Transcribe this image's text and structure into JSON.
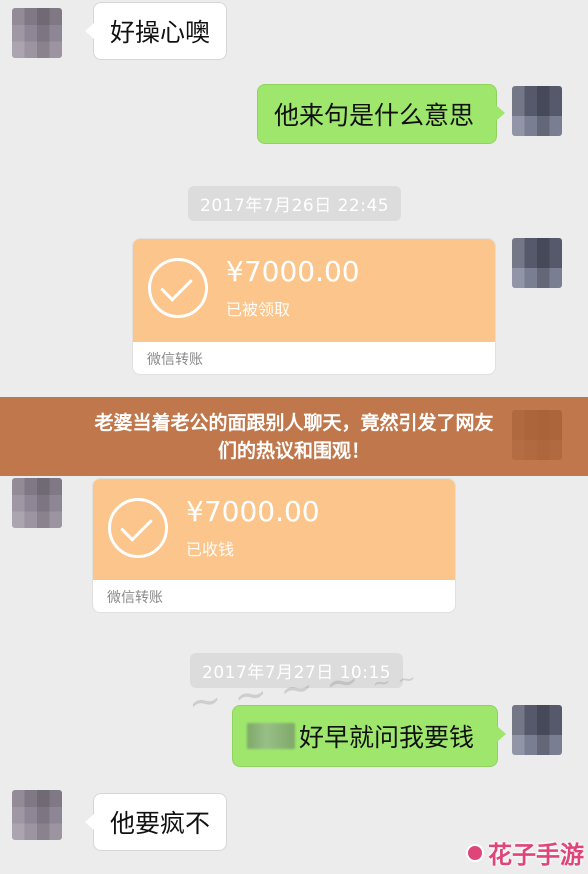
{
  "messages": {
    "m1": "好操心噢",
    "m2": "他来句是什么意思",
    "m5": "好早就问我要钱",
    "m6": "他要疯不"
  },
  "timestamps": {
    "t1": "2017年7月26日 22:45",
    "t2": "2017年7月27日 10:15"
  },
  "transfers": {
    "sent": {
      "amount": "¥7000.00",
      "status": "已被领取",
      "footer": "微信转账"
    },
    "received": {
      "amount": "¥7000.00",
      "status": "已收钱",
      "footer": "微信转账"
    }
  },
  "banner": {
    "line1": "老婆当着老公的面跟别人聊天，竟然引发了网友",
    "line2": "们的热议和围观！"
  },
  "logo": {
    "text": "花子手游"
  },
  "colors": {
    "chat_bg": "#ececec",
    "green_bubble": "#9fe66d",
    "transfer_orange": "#fbc58b",
    "banner": "#b86634",
    "logo": "#e0457a"
  }
}
